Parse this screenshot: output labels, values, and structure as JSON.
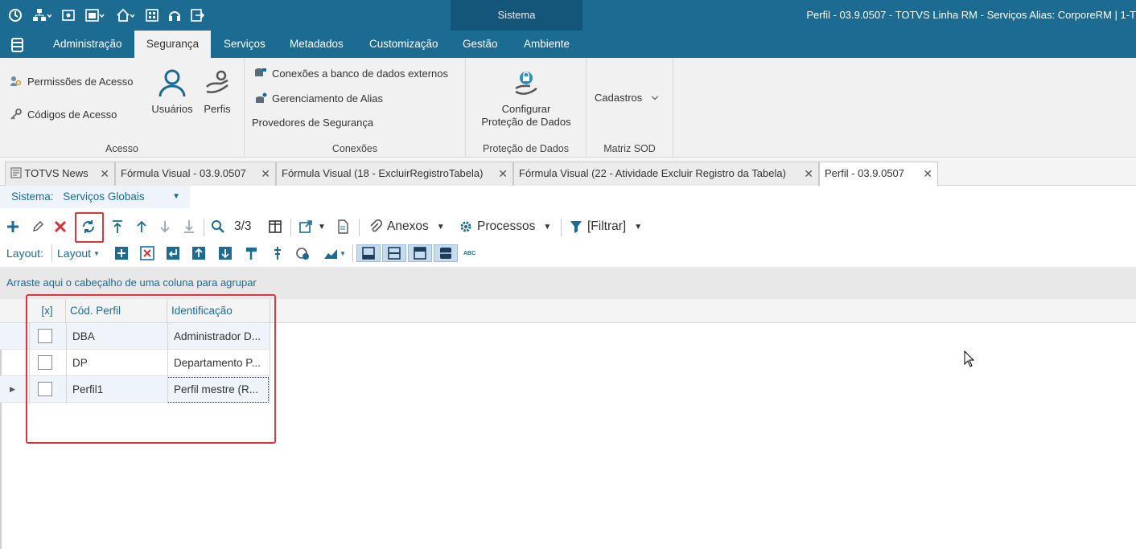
{
  "window": {
    "title": "Perfil - 03.9.0507 - TOTVS Linha RM - Serviços  Alias: CorporeRM | 1-T",
    "context_tab": "Sistema"
  },
  "menu": {
    "items": [
      "Administração",
      "Segurança",
      "Serviços",
      "Metadados",
      "Customização",
      "Gestão",
      "Ambiente"
    ],
    "active": "Segurança"
  },
  "ribbon": {
    "acesso": {
      "title": "Acesso",
      "permissoes": "Permissões de Acesso",
      "codigos": "Códigos de Acesso",
      "usuarios": "Usuários",
      "perfis": "Perfis"
    },
    "conexoes": {
      "title": "Conexões",
      "bancos": "Conexões a banco de dados externos",
      "alias": "Gerenciamento de Alias",
      "provedores": "Provedores de Segurança"
    },
    "protecao": {
      "title": "Proteção de Dados",
      "configurar_l1": "Configurar",
      "configurar_l2": "Proteção de Dados"
    },
    "matriz": {
      "title": "Matriz SOD",
      "cadastros": "Cadastros"
    }
  },
  "doc_tabs": [
    "TOTVS News",
    "Fórmula Visual - 03.9.0507",
    "Fórmula Visual (18 - ExcluirRegistroTabela)",
    "Fórmula Visual (22 - Atividade Excluir Registro da Tabela)",
    "Perfil - 03.9.0507"
  ],
  "system_selector": {
    "label": "Sistema:",
    "value": "Serviços Globais"
  },
  "toolbar": {
    "record_count": "3/3",
    "anexos": "Anexos",
    "processos": "Processos",
    "filtrar": "[Filtrar]"
  },
  "layout_bar": {
    "label": "Layout:",
    "layout_menu": "Layout",
    "abc": "ABC"
  },
  "group_hint": "Arraste aqui o cabeçalho de uma coluna para agrupar",
  "grid": {
    "columns": [
      "[x]",
      "Cód. Perfil",
      "Identificação"
    ],
    "rows": [
      {
        "codigo": "DBA",
        "identificacao": "Administrador D..."
      },
      {
        "codigo": "DP",
        "identificacao": "Departamento P..."
      },
      {
        "codigo": "Perfil1",
        "identificacao": "Perfil mestre (R..."
      }
    ]
  },
  "colors": {
    "brand": "#1b6b93",
    "highlight": "#d9363e",
    "context": "#14557a"
  }
}
